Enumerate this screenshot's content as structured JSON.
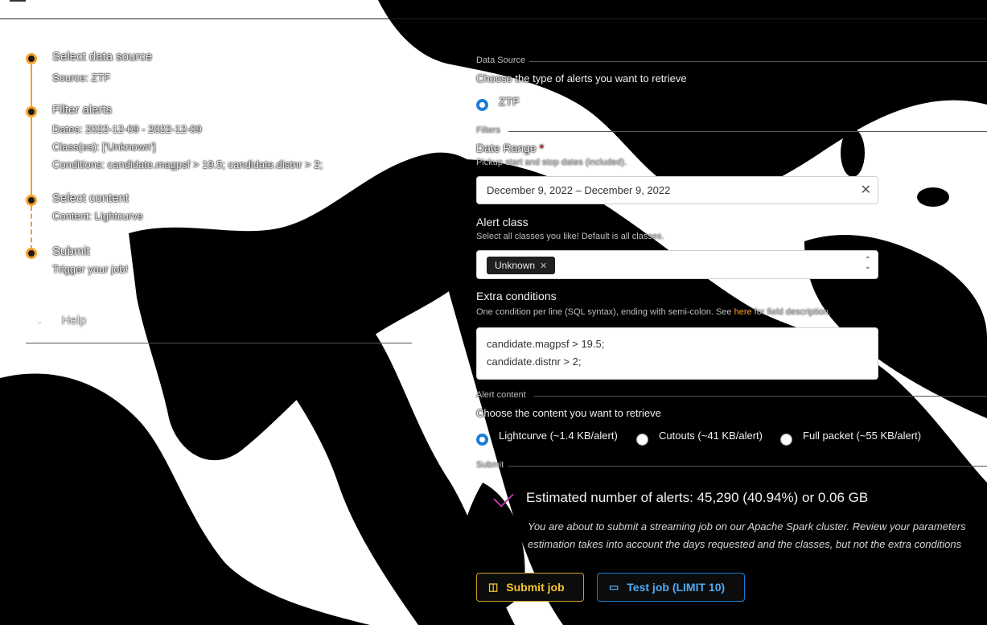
{
  "stepper": {
    "steps": [
      {
        "title": "Select data source",
        "desc": [
          "Source: ZTF"
        ]
      },
      {
        "title": "Filter alerts",
        "desc": [
          "Dates: 2022-12-09 - 2022-12-09",
          "Class(es): ['Unknown']",
          "Conditions: candidate.magpsf > 19.5; candidate.distnr > 2;"
        ]
      },
      {
        "title": "Select content",
        "desc": [
          "Content: Lightcurve"
        ]
      },
      {
        "title": "Submit",
        "desc": [
          "Trigger your job!"
        ]
      }
    ],
    "help_label": "Help"
  },
  "form": {
    "data_source": {
      "legend": "Data Source",
      "prompt": "Choose the type of alerts you want to retrieve",
      "option": "ZTF"
    },
    "filters": {
      "legend": "Filters",
      "date_label": "Date Range",
      "required_mark": "*",
      "date_hint": "Pickup start and stop dates (included).",
      "date_value": "December 9, 2022 – December 9, 2022",
      "class_label": "Alert class",
      "class_hint": "Select all classes you like! Default is all classes.",
      "class_chip": "Unknown",
      "extra_label": "Extra conditions",
      "extra_hint_pre": "One condition per line (SQL syntax), ending with semi-colon. See ",
      "extra_hint_link": "here",
      "extra_hint_post": " for field description.",
      "extra_lines": [
        "candidate.magpsf > 19.5;",
        "candidate.distnr > 2;"
      ]
    },
    "alert_content": {
      "legend": "Alert content",
      "prompt": "Choose the content you want to retrieve",
      "options": [
        "Lightcurve (~1.4 KB/alert)",
        "Cutouts (~41 KB/alert)",
        "Full packet (~55 KB/alert)"
      ]
    },
    "submit": {
      "legend": "Submit",
      "estimate": "Estimated number of alerts: 45,290 (40.94%) or 0.06 GB",
      "note_line1": "You are about to submit a streaming job on our Apache Spark cluster. Review your parameters",
      "note_line2": "estimation takes into account the days requested and the classes, but not the extra conditions",
      "submit_btn": "Submit job",
      "test_btn": "Test job (LIMIT 10)"
    }
  }
}
